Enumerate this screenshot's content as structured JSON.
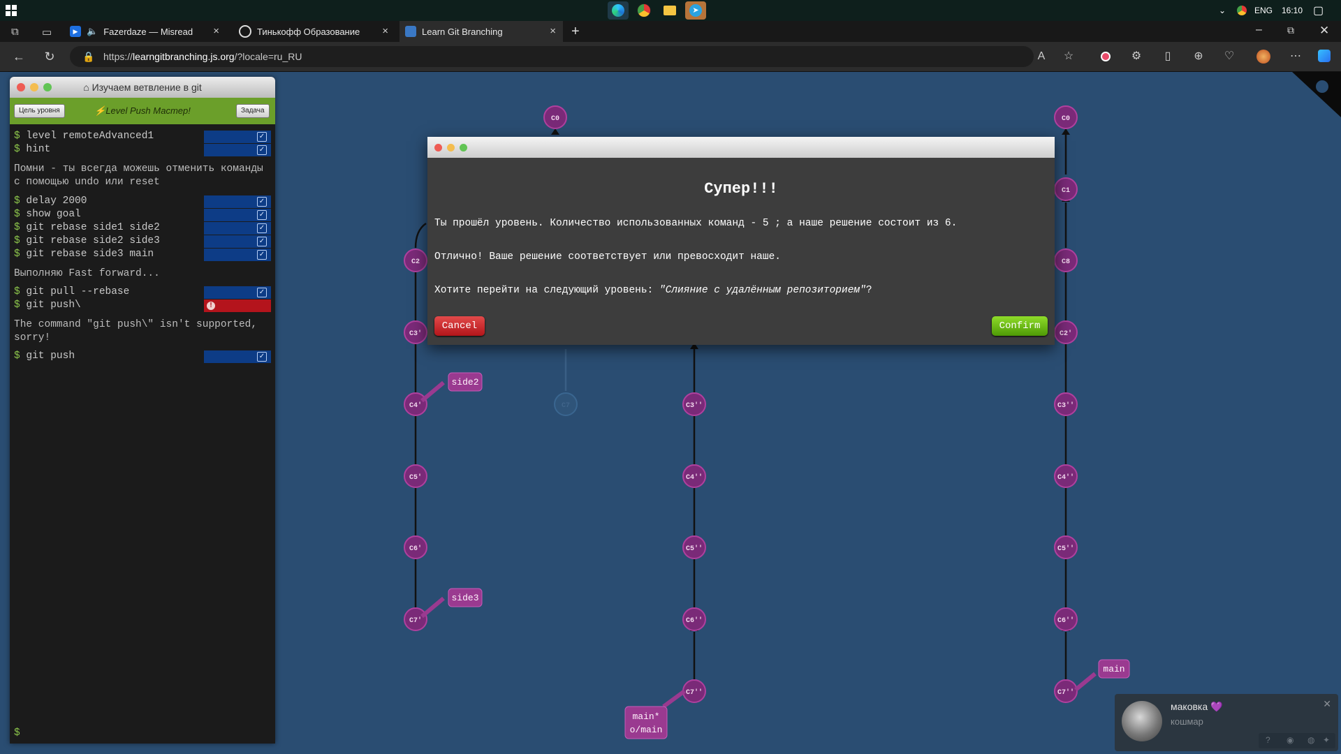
{
  "taskbar": {
    "language": "ENG",
    "time": "16:10"
  },
  "browser": {
    "tabs": [
      {
        "title": "Fazerdaze — Misread"
      },
      {
        "title": "Тинькофф Образование"
      },
      {
        "title": "Learn Git Branching"
      }
    ],
    "url_prefix": "https://",
    "url_host": "learngitbranching.js.org",
    "url_path": "/?locale=ru_RU"
  },
  "terminal": {
    "window_title": "Изучаем ветвление в git",
    "goal_button": "Цель уровня",
    "level_label": "Level Push Мастер!",
    "task_button": "Задача",
    "prompt": "$",
    "lines": [
      {
        "text": "level remoteAdvanced1"
      },
      {
        "text": "hint"
      },
      {
        "text": "delay 2000"
      },
      {
        "text": "show goal"
      },
      {
        "text": "git rebase side1 side2"
      },
      {
        "text": "git rebase side2 side3"
      },
      {
        "text": "git rebase side3 main"
      },
      {
        "text": "git pull --rebase"
      },
      {
        "text": "git push\\"
      },
      {
        "text": "git push"
      }
    ],
    "messages": [
      "Помни - ты всегда можешь отменить команды с помощью undo или reset",
      "Выполняю Fast forward...",
      "The command \"git push\\\" isn't supported, sorry!"
    ]
  },
  "modal": {
    "title": "Супер!!!",
    "line1": "Ты прошёл уровень. Количество использованных команд - 5 ; а наше решение состоит из 6.",
    "line2": "Отлично! Ваше решение соответствует или превосходит наше.",
    "line3_prefix": "Хотите перейти на следующий уровень: ",
    "line3_level": "\"Слияние с удалённым репозиторием\"",
    "line3_suffix": "?",
    "cancel": "Cancel",
    "confirm": "Confirm"
  },
  "graph": {
    "left_tree": {
      "nodes": [
        "C0",
        "C2",
        "C3'",
        "C4'",
        "C5'",
        "C6'",
        "C7'",
        "C7"
      ],
      "branches": [
        "side2",
        "side3"
      ]
    },
    "middle_tree": {
      "nodes": [
        "C3''",
        "C4''",
        "C5''",
        "C6''",
        "C7''"
      ],
      "branches": [
        "main*",
        "o/main"
      ]
    },
    "right_tree": {
      "nodes": [
        "C0",
        "C1",
        "C8",
        "C2'",
        "C3''",
        "C4''",
        "C5''",
        "C6''",
        "C7''"
      ],
      "branches": [
        "main"
      ]
    },
    "colors": {
      "node": "#7a2a78",
      "node_border": "#b0409e",
      "edge": "#111111",
      "branch_label_bg": "#9a3a90"
    }
  },
  "notification": {
    "name": "маковка 💜",
    "message": "кошмар"
  }
}
